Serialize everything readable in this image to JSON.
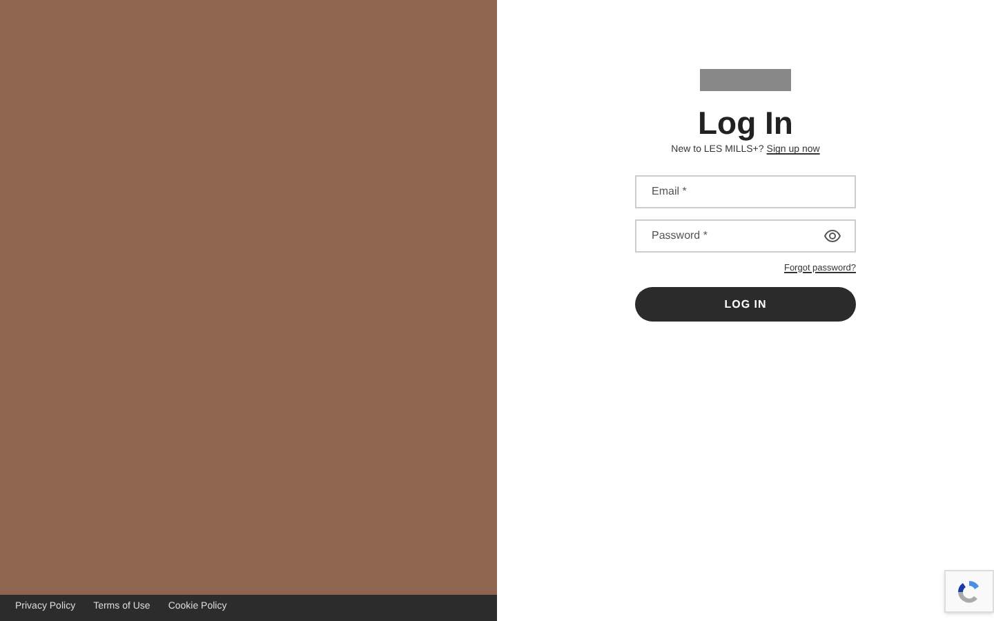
{
  "footer": {
    "links": [
      "Privacy Policy",
      "Terms of Use",
      "Cookie Policy"
    ]
  },
  "login": {
    "title": "Log In",
    "prompt": "New to LES MILLS+?",
    "signup_link": "Sign up now",
    "fields": [
      {
        "placeholder": "Email *",
        "kind": "text"
      },
      {
        "placeholder": "Password *",
        "kind": "password"
      }
    ],
    "forgot_link": "Forgot password?",
    "submit": "LOG IN"
  }
}
